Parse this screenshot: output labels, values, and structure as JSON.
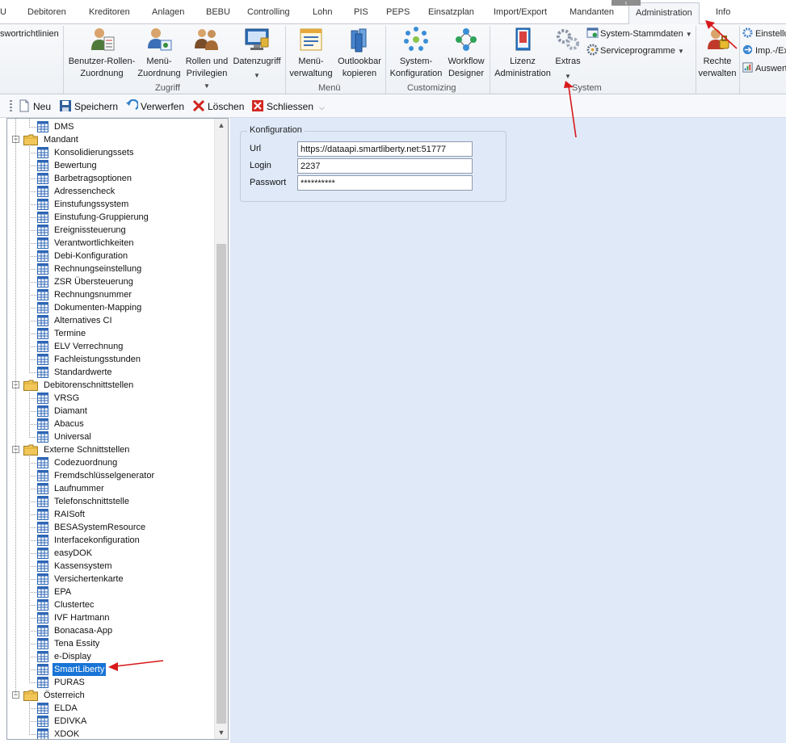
{
  "menu": {
    "tabs": [
      "U",
      "Debitoren",
      "Kreditoren",
      "Anlagen",
      "BEBU",
      "Controlling",
      "Lohn",
      "PIS",
      "PEPS",
      "Einsatzplan",
      "Import/Export",
      "Mandanten",
      "Administration",
      "Info"
    ],
    "active_tab": "Administration"
  },
  "ribbon": {
    "left_fragment": "swortrichtlinien",
    "zugriff": {
      "label": "Zugriff",
      "buttons": [
        {
          "label": "Benutzer-Rollen-\nZuordnung",
          "icon": "user-roles-icon"
        },
        {
          "label": "Menü-\nZuordnung",
          "icon": "menu-assignment-icon"
        },
        {
          "label": "Rollen und\nPrivilegien",
          "icon": "roles-privileges-icon"
        },
        {
          "label": "Datenzugriff",
          "icon": "data-access-icon"
        }
      ]
    },
    "menue": {
      "label": "Menü",
      "buttons": [
        {
          "label": "Menü-\nverwaltung",
          "icon": "menu-management-icon"
        },
        {
          "label": "Outlookbar\nkopieren",
          "icon": "outlookbar-copy-icon"
        }
      ]
    },
    "customizing": {
      "label": "Customizing",
      "buttons": [
        {
          "label": "System-\nKonfiguration",
          "icon": "system-config-icon"
        },
        {
          "label": "Workflow\nDesigner",
          "icon": "workflow-designer-icon"
        }
      ]
    },
    "system": {
      "label": "System",
      "buttons": [
        {
          "label": "Lizenz\nAdministration",
          "icon": "license-icon"
        },
        {
          "label": "Extras",
          "icon": "extras-gears-icon"
        }
      ],
      "small_buttons": [
        {
          "label": "System-Stammdaten",
          "icon": "system-masterdata-icon"
        },
        {
          "label": "Serviceprogramme",
          "icon": "service-programs-icon"
        }
      ]
    },
    "rights": {
      "buttons": [
        {
          "label": "Rechte\nverwalten",
          "icon": "rights-manage-icon"
        }
      ],
      "small_buttons": [
        {
          "label": "Einstellu",
          "icon": "settings-icon"
        },
        {
          "label": "Imp.-/Ex",
          "icon": "import-export-icon"
        },
        {
          "label": "Auswert",
          "icon": "evaluation-icon"
        }
      ]
    }
  },
  "toolbar": {
    "new": "Neu",
    "save": "Speichern",
    "discard": "Verwerfen",
    "delete": "Löschen",
    "close": "Schliessen"
  },
  "tree": {
    "top_leaves": [
      "DMS"
    ],
    "folders": [
      {
        "name": "Mandant",
        "items": [
          "Konsolidierungssets",
          "Bewertung",
          "Barbetragsoptionen",
          "Adressencheck",
          "Einstufungssystem",
          "Einstufung-Gruppierung",
          "Ereignissteuerung",
          "Verantwortlichkeiten",
          "Debi-Konfiguration",
          "Rechnungseinstellung",
          "ZSR Übersteuerung",
          "Rechnungsnummer",
          "Dokumenten-Mapping",
          "Alternatives CI",
          "Termine",
          "ELV Verrechnung",
          "Fachleistungsstunden",
          "Standardwerte"
        ]
      },
      {
        "name": "Debitorenschnittstellen",
        "items": [
          "VRSG",
          "Diamant",
          "Abacus",
          "Universal"
        ]
      },
      {
        "name": "Externe Schnittstellen",
        "items": [
          "Codezuordnung",
          "Fremdschlüsselgenerator",
          "Laufnummer",
          "Telefonschnittstelle",
          "RAISoft",
          "BESASystemResource",
          "Interfacekonfiguration",
          "easyDOK",
          "Kassensystem",
          "Versichertenkarte",
          "EPA",
          "Clustertec",
          "IVF Hartmann",
          "Bonacasa-App",
          "Tena Essity",
          "e-Display",
          "SmartLiberty",
          "PURAS"
        ]
      },
      {
        "name": "Österreich",
        "items": [
          "ELDA",
          "EDIVKA",
          "XDOK"
        ]
      }
    ],
    "selected": "SmartLiberty"
  },
  "config": {
    "legend": "Konfiguration",
    "url_label": "Url",
    "url_value": "https://dataapi.smartliberty.net:51777",
    "login_label": "Login",
    "login_value": "2237",
    "password_label": "Passwort",
    "password_value": "**********"
  },
  "colors": {
    "selection": "#1874d6",
    "content_bg": "#dfe9f8",
    "annotation_arrow": "#d7191c"
  }
}
